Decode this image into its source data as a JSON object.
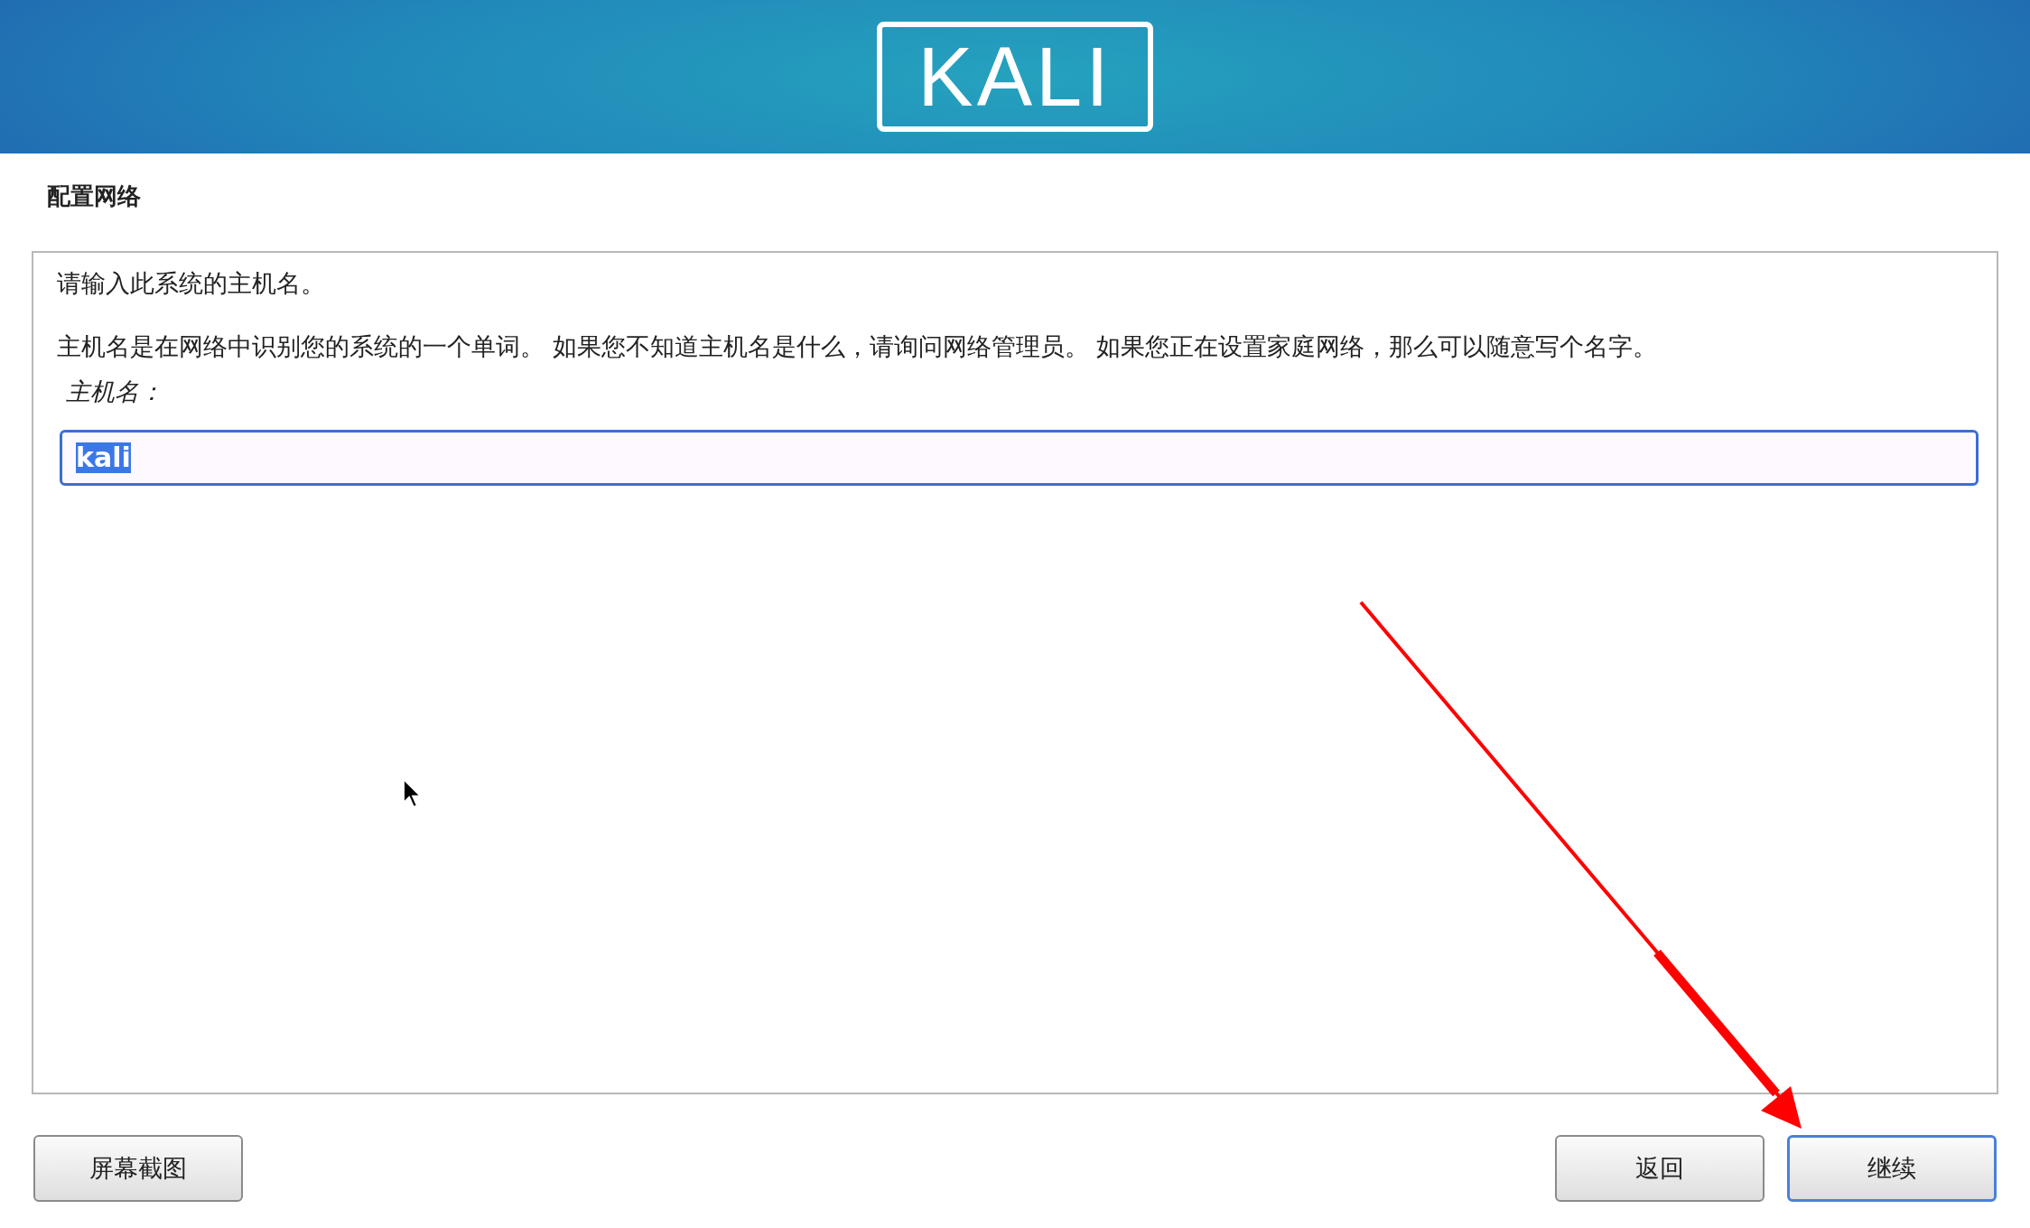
{
  "header": {
    "logo": "KALI"
  },
  "page_title": "配置网络",
  "prompt": "请输入此系统的主机名。",
  "description": "主机名是在网络中识别您的系统的一个单词。 如果您不知道主机名是什么，请询问网络管理员。 如果您正在设置家庭网络，那么可以随意写个名字。",
  "hostname_field": {
    "label": "主机名：",
    "value": "kali",
    "text_selected": true
  },
  "buttons": [
    {
      "label": "屏幕截图",
      "focused": false,
      "kind": "left"
    },
    {
      "label": "返回",
      "focused": false,
      "kind": "right"
    },
    {
      "label": "继续",
      "focused": true,
      "kind": "right"
    }
  ]
}
